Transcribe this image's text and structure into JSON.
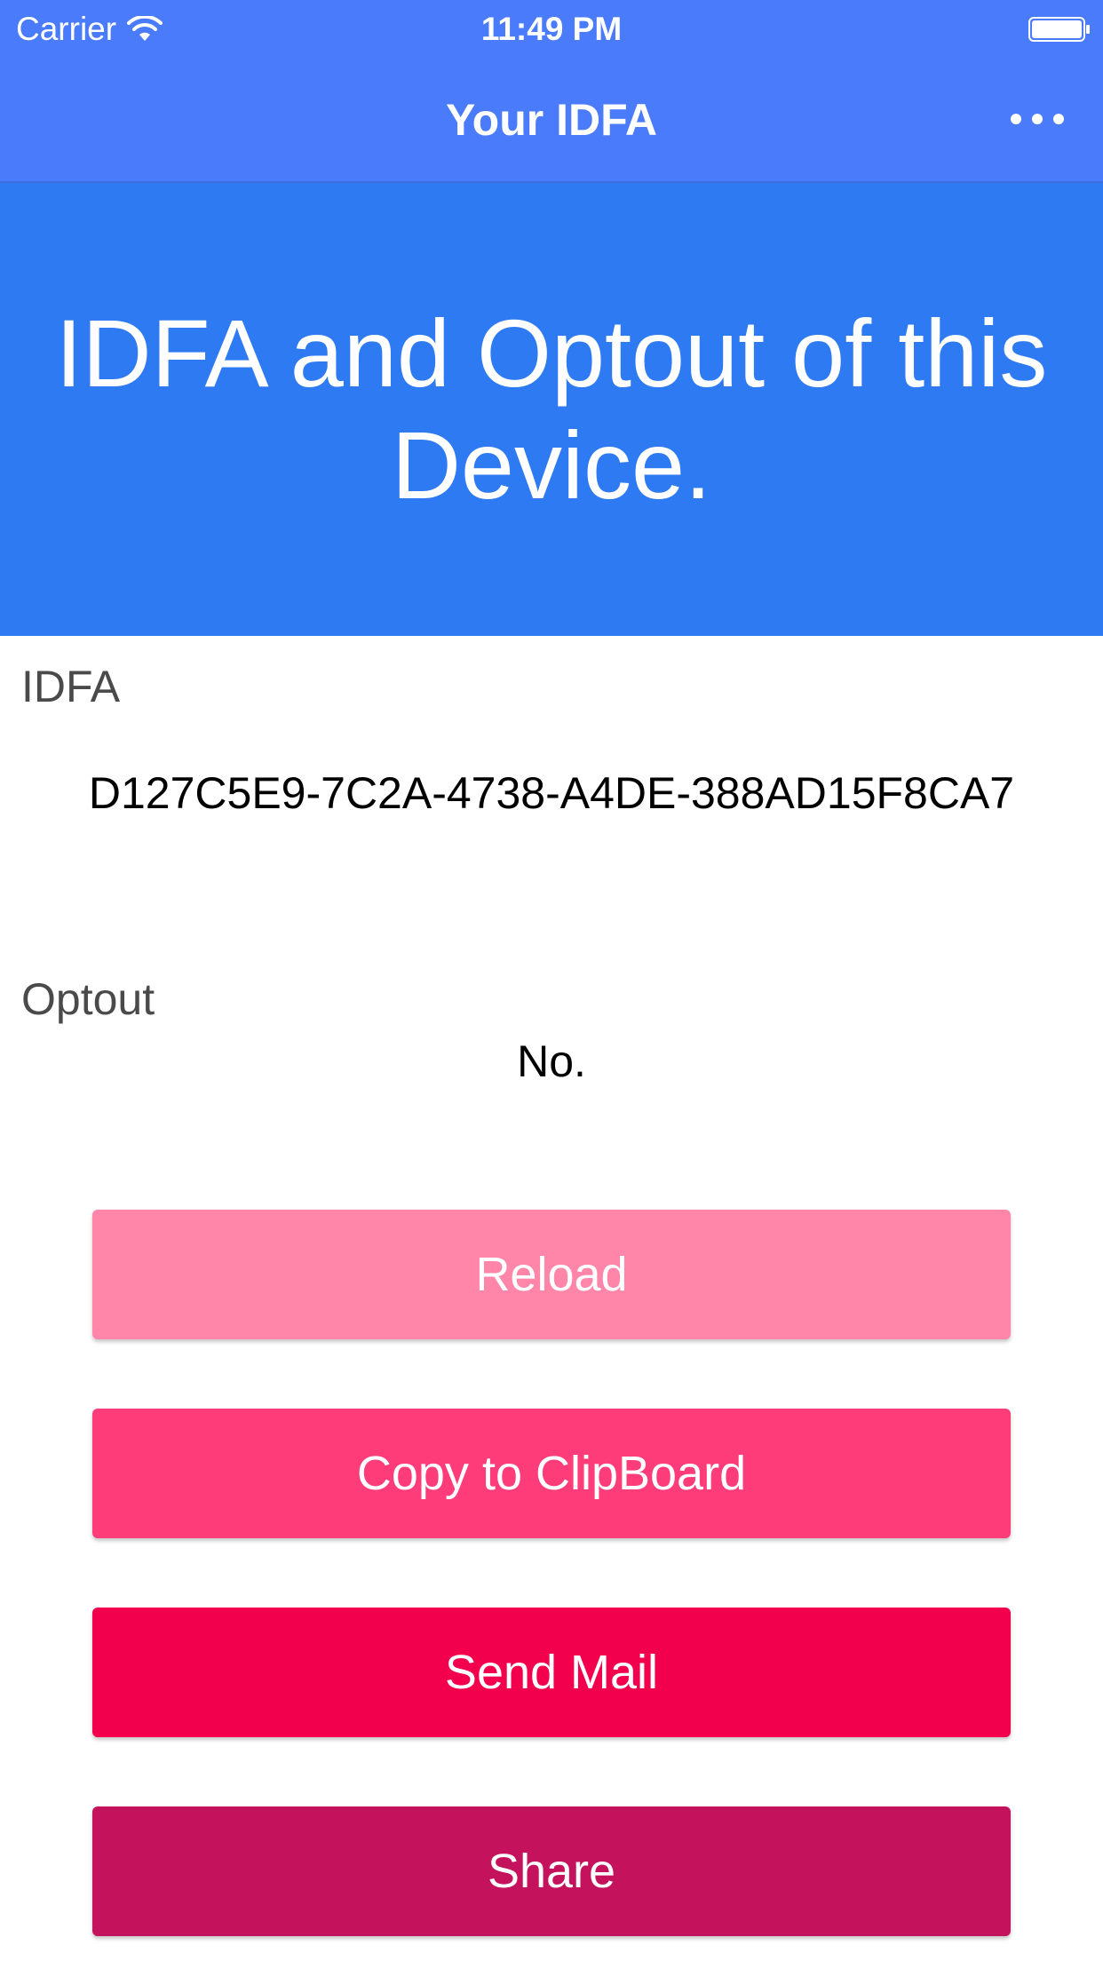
{
  "status_bar": {
    "carrier": "Carrier",
    "time": "11:49 PM",
    "wifi_icon": "wifi-icon",
    "battery_icon": "battery-icon"
  },
  "nav_bar": {
    "title": "Your IDFA",
    "more_icon": "more-horizontal-icon"
  },
  "hero": {
    "text": "IDFA and Optout of this Device."
  },
  "idfa": {
    "label": "IDFA",
    "value": "D127C5E9-7C2A-4738-A4DE-388AD15F8CA7"
  },
  "optout": {
    "label": "Optout",
    "value": "No."
  },
  "buttons": {
    "reload": "Reload",
    "copy": "Copy to ClipBoard",
    "mail": "Send Mail",
    "share": "Share"
  },
  "colors": {
    "nav_background": "#4a7bfb",
    "hero_background": "#2d7af3",
    "reload_button": "#ff85a9",
    "copy_button": "#ff3c7a",
    "mail_button": "#f2004d",
    "share_button": "#c4135c"
  }
}
